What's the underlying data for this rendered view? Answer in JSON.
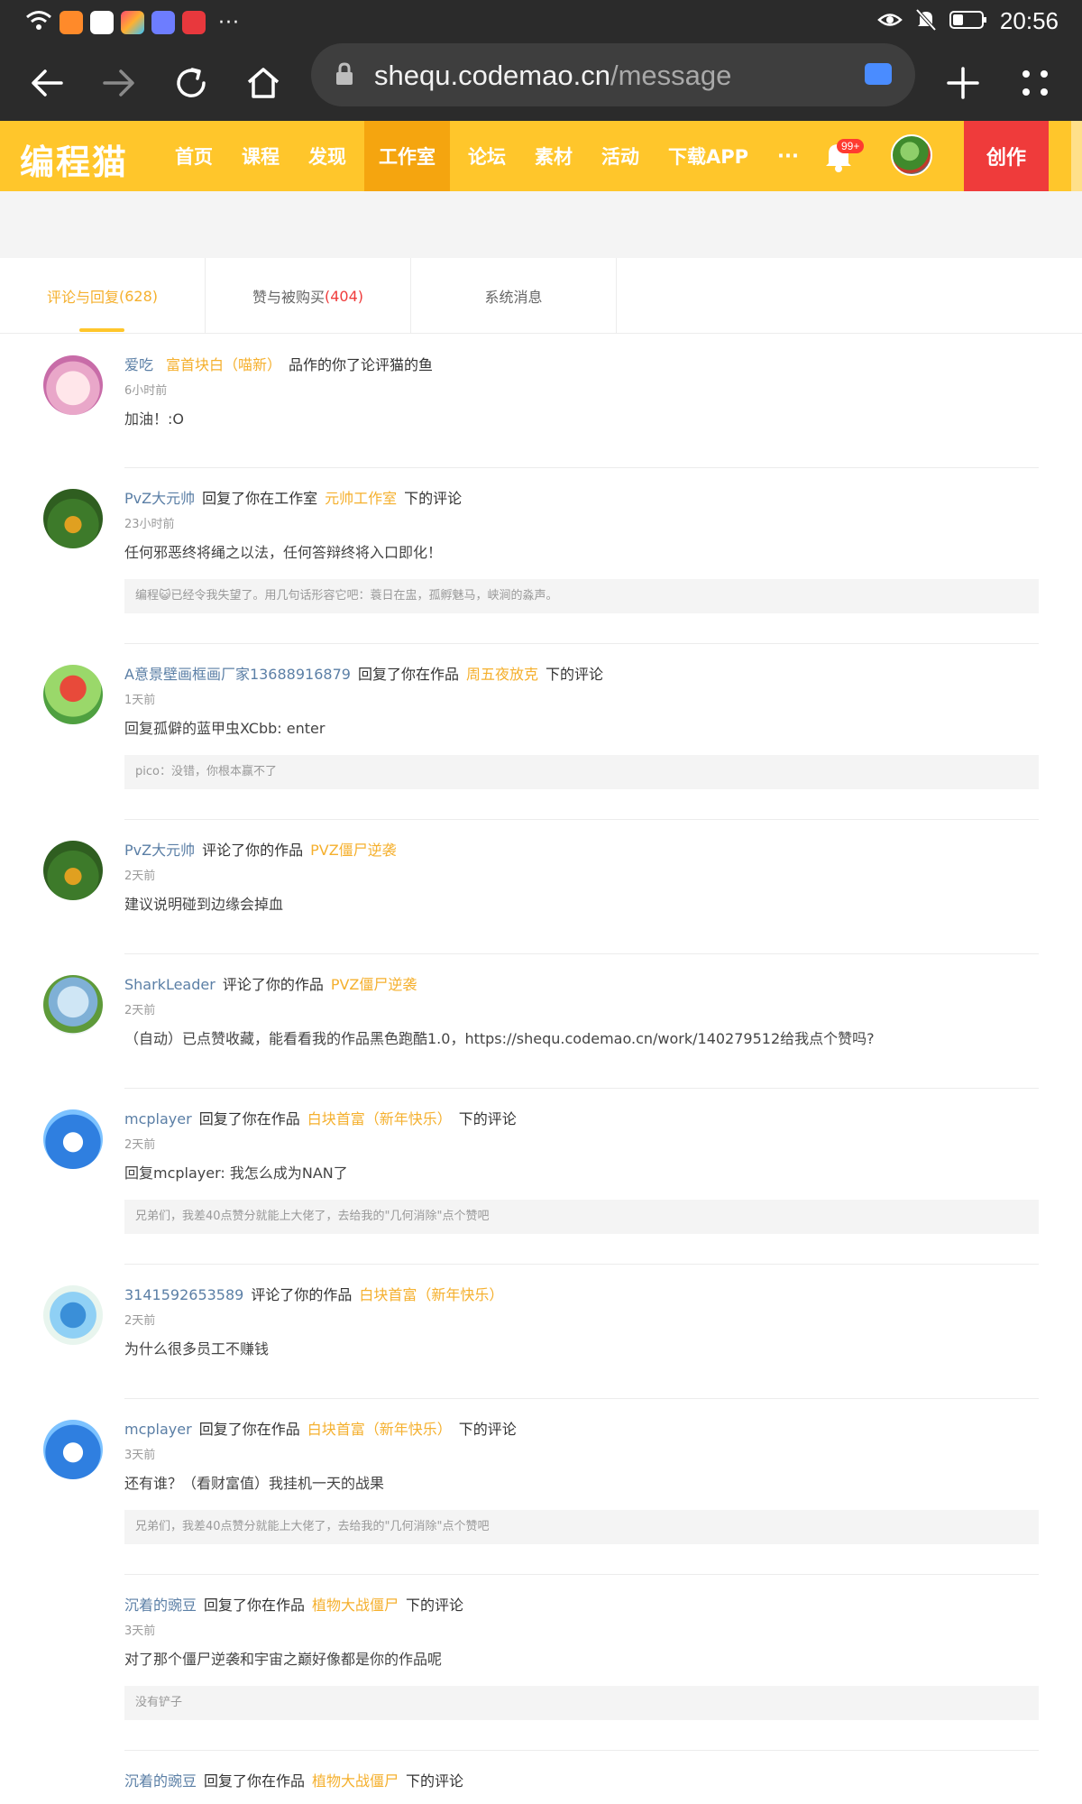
{
  "status_bar": {
    "time": "20:56",
    "more_dots": "···"
  },
  "browser": {
    "url_domain": "shequ.codemao.cn",
    "url_path": "/message"
  },
  "site": {
    "logo": "编程猫",
    "nav": [
      "首页",
      "课程",
      "发现",
      "工作室",
      "论坛",
      "素材",
      "活动",
      "下载APP",
      "···"
    ],
    "active_nav_index": 3,
    "notification_badge": "99+",
    "create_label": "创作"
  },
  "tabs": [
    {
      "label": "评论与回复",
      "count": "(628)",
      "active": true
    },
    {
      "label": "赞与被购买",
      "count": "(404)",
      "active": false
    },
    {
      "label": "系统消息",
      "count": "",
      "active": false
    }
  ],
  "messages": [
    {
      "user": "爱吃",
      "action": "",
      "work": "富首块白（喵新）",
      "tail": "品作的你了论评猫的鱼",
      "time": "6小时前",
      "content": "加油！:O",
      "quote": ""
    },
    {
      "user": "PvZ大元帅",
      "action": "回复了你在工作室",
      "work": "元帅工作室",
      "tail": "下的评论",
      "time": "23小时前",
      "content": "任何邪恶终将绳之以法，任何答辩终将入口即化！",
      "quote": "编程😺已经令我失望了。用几句话形容它吧：蓑日在盅，孤孵魅马，峡涧的淼声。"
    },
    {
      "user": "A意景壁画框画厂家13688916879",
      "action": "回复了你在作品",
      "work": "周五夜放克",
      "tail": "下的评论",
      "time": "1天前",
      "content": "回复孤僻的蓝甲虫XCbb:    enter",
      "quote": "pico：没错，你根本赢不了"
    },
    {
      "user": "PvZ大元帅",
      "action": "评论了你的作品",
      "work": "PVZ僵尸逆袭",
      "tail": "",
      "time": "2天前",
      "content": "建议说明碰到边缘会掉血",
      "quote": ""
    },
    {
      "user": "SharkLeader",
      "action": "评论了你的作品",
      "work": "PVZ僵尸逆袭",
      "tail": "",
      "time": "2天前",
      "content": "（自动）已点赞收藏，能看看我的作品黑色跑酷1.0，https://shequ.codemao.cn/work/140279512给我点个赞吗?",
      "quote": ""
    },
    {
      "user": "mcplayer",
      "action": "回复了你在作品",
      "work": "白块首富（新年快乐）",
      "tail": "下的评论",
      "time": "2天前",
      "content": "回复mcplayer:    我怎么成为NAN了",
      "quote": "兄弟们，我差40点赞分就能上大佬了，去给我的\"几何消除\"点个赞吧"
    },
    {
      "user": "3141592653589",
      "action": "评论了你的作品",
      "work": "白块首富（新年快乐）",
      "tail": "",
      "time": "2天前",
      "content": "为什么很多员工不赚钱",
      "quote": ""
    },
    {
      "user": "mcplayer",
      "action": "回复了你在作品",
      "work": "白块首富（新年快乐）",
      "tail": "下的评论",
      "time": "3天前",
      "content": "还有谁？（看财富值）我挂机一天的战果",
      "quote": "兄弟们，我差40点赞分就能上大佬了，去给我的\"几何消除\"点个赞吧"
    },
    {
      "user": "沉着的豌豆",
      "action": "回复了你在作品",
      "work": "植物大战僵尸",
      "tail": "下的评论",
      "time": "3天前",
      "content": "对了那个僵尸逆袭和宇宙之巅好像都是你的作品呢",
      "quote": "没有铲子"
    },
    {
      "user": "沉着的豌豆",
      "action": "回复了你在作品",
      "work": "植物大战僵尸",
      "tail": "下的评论",
      "time": "",
      "content": "",
      "quote": ""
    }
  ]
}
